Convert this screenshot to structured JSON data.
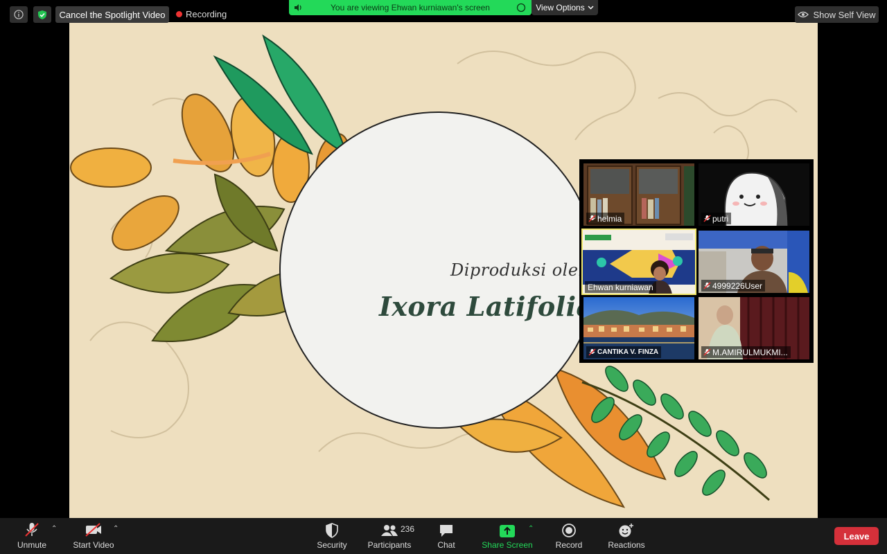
{
  "topbar": {
    "spotlight_label": "Cancel the Spotlight Video",
    "recording_label": "Recording",
    "viewing_label": "You are viewing Ehwan kurniawan's screen",
    "view_options_label": "View Options",
    "self_view_label": "Show Self View"
  },
  "slide": {
    "line1": "Diproduksi oleh :",
    "line2": "Ixora Latifolia Binersa"
  },
  "participants_tiles": [
    {
      "name": "helmia",
      "muted": true
    },
    {
      "name": "putri",
      "muted": true
    },
    {
      "name": "Ehwan kurniawan",
      "muted": false,
      "active": true
    },
    {
      "name": "4999226User",
      "muted": true
    },
    {
      "name": "CANTIKA V. FINZA",
      "muted": true
    },
    {
      "name": "M.AMIRULMUKMI...",
      "muted": true
    }
  ],
  "toolbar": {
    "unmute_label": "Unmute",
    "start_video_label": "Start Video",
    "security_label": "Security",
    "participants_label": "Participants",
    "participants_count": "236",
    "chat_label": "Chat",
    "share_screen_label": "Share Screen",
    "record_label": "Record",
    "reactions_label": "Reactions",
    "leave_label": "Leave"
  },
  "colors": {
    "share_green": "#23d959",
    "leave_red": "#d5303a",
    "active_speaker": "#f2e96e"
  }
}
